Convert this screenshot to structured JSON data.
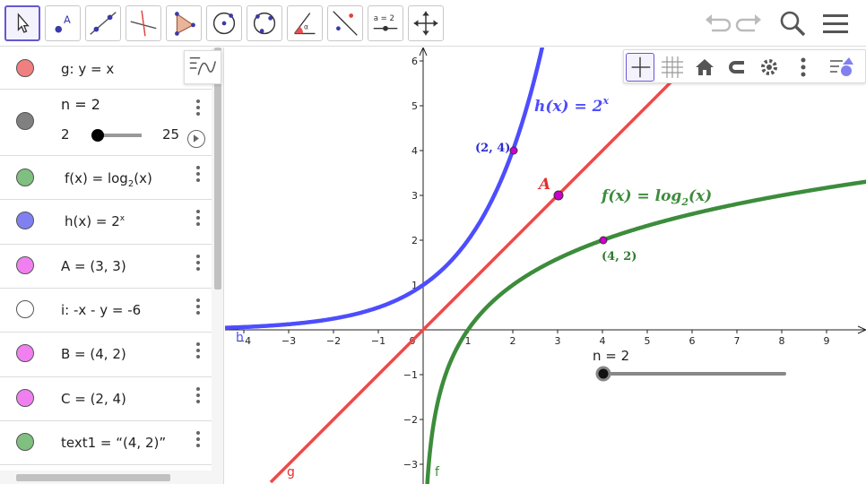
{
  "toolbar": {
    "tools": [
      {
        "name": "move-tool",
        "label": ""
      },
      {
        "name": "point-tool",
        "label": "A"
      },
      {
        "name": "line-tool",
        "label": ""
      },
      {
        "name": "perpendicular-tool",
        "label": ""
      },
      {
        "name": "polygon-tool",
        "label": ""
      },
      {
        "name": "circle-center-tool",
        "label": ""
      },
      {
        "name": "circle-three-points-tool",
        "label": ""
      },
      {
        "name": "angle-tool",
        "label": "α"
      },
      {
        "name": "reflect-tool",
        "label": ""
      },
      {
        "name": "slider-tool",
        "label": "a = 2"
      },
      {
        "name": "move-graphics-tool",
        "label": ""
      }
    ]
  },
  "algebra": {
    "rows": [
      {
        "name": "g",
        "color": "#f08080",
        "text": "g: y = x"
      },
      {
        "name": "n",
        "color": "#808080",
        "text": "n = 2",
        "slider_min": "2",
        "slider_max": "25",
        "slider_value": 2
      },
      {
        "name": "f",
        "color": "#7fbf7f",
        "text_prefix": "f(x)  =  log",
        "text_sub": "2",
        "text_suffix": "(x)"
      },
      {
        "name": "h",
        "color": "#8080f0",
        "text_prefix": "h(x)  =  2",
        "text_sup": "x"
      },
      {
        "name": "A",
        "color": "#f080f0",
        "text": "A = (3, 3)"
      },
      {
        "name": "i",
        "color": "#ffffff",
        "text": "i: -x - y = -6"
      },
      {
        "name": "B",
        "color": "#f080f0",
        "text": "B = (4, 2)"
      },
      {
        "name": "C",
        "color": "#f080f0",
        "text": "C = (2, 4)"
      },
      {
        "name": "text1",
        "color": "#7fbf7f",
        "text": "text1 = “(4, 2)”"
      }
    ]
  },
  "graphics": {
    "x_ticks": [
      "−4",
      "−3",
      "−2",
      "−1",
      "0",
      "1",
      "2",
      "3",
      "4",
      "5",
      "6",
      "7",
      "8",
      "9"
    ],
    "y_ticks": [
      "−3",
      "−2",
      "−1",
      "1",
      "2",
      "3",
      "4",
      "5",
      "6"
    ],
    "labels": {
      "h_label": "h(x) = 2",
      "h_sup": "x",
      "f_label": "f(x) = log",
      "f_sub": "2",
      "f_suffix": "(x)",
      "point_A": "A",
      "point_C_text": "(2, 4)",
      "point_B_text": "(4, 2)",
      "curve_g": "g",
      "curve_f": "f",
      "curve_h": "h",
      "slider_label": "n = 2"
    },
    "colors": {
      "h": "#4d4dff",
      "g": "#f04848",
      "f": "#3c8c3c",
      "point": "#cc00cc"
    }
  }
}
